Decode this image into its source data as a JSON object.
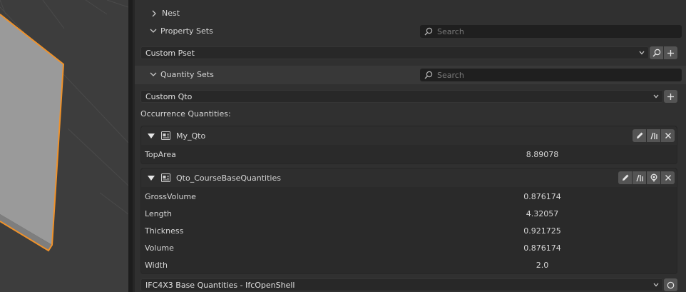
{
  "nest": {
    "label": "Nest"
  },
  "property_sets": {
    "label": "Property Sets",
    "search_placeholder": "Search",
    "selected": "Custom Pset"
  },
  "quantity_sets": {
    "label": "Quantity Sets",
    "search_placeholder": "Search",
    "selected": "Custom Qto"
  },
  "occurrence_label": "Occurrence Quantities:",
  "qsets": [
    {
      "name": "My_Qto",
      "rows": [
        {
          "name": "TopArea",
          "value": "8.89078"
        }
      ]
    },
    {
      "name": "Qto_CourseBaseQuantities",
      "rows": [
        {
          "name": "GrossVolume",
          "value": "0.876174"
        },
        {
          "name": "Length",
          "value": "4.32057"
        },
        {
          "name": "Thickness",
          "value": "0.921725"
        },
        {
          "name": "Volume",
          "value": "0.876174"
        },
        {
          "name": "Width",
          "value": "2.0"
        }
      ]
    }
  ],
  "base_quantities": {
    "selected": "IFC4X3 Base Quantities - IfcOpenShell"
  },
  "colors": {
    "selection_outline": "#f0922a",
    "panel_bg": "#303030",
    "field_bg": "#1f1f1f"
  }
}
